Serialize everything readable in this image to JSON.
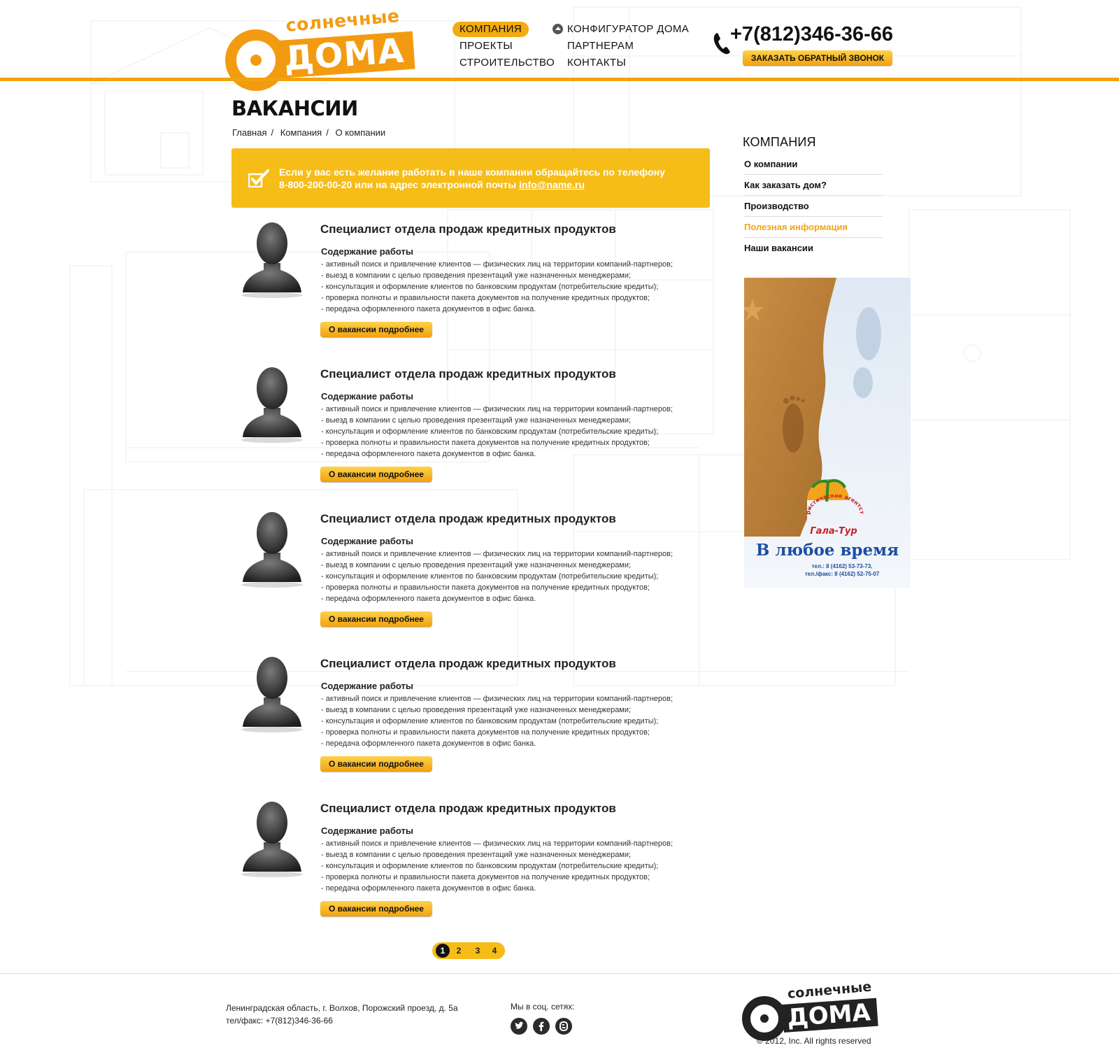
{
  "logo": {
    "top_text": "солнечные",
    "bottom_text": "ДОМА"
  },
  "nav": {
    "col1": [
      "КОМПАНИЯ",
      "ПРОЕКТЫ",
      "СТРОИТЕЛЬСТВО"
    ],
    "col2": [
      "КОНФИГУРАТОР ДОМА",
      "ПАРТНЕРАМ",
      "КОНТАКТЫ"
    ],
    "active": "КОМПАНИЯ"
  },
  "contact": {
    "phone": "+7(812)346-36-66",
    "callback_label": "ЗАКАЗАТЬ ОБРАТНЫЙ ЗВОНОК"
  },
  "page": {
    "title": "ВАКАНСИИ",
    "breadcrumb": [
      "Главная",
      "Компания",
      "О компании"
    ],
    "breadcrumb_sep": "/"
  },
  "notice": {
    "text_line1": "Если у вас есть желание работать в наше компании обращайтесь по телефону",
    "text_line2": "8-800-200-00-20 или на адрес электронной почты",
    "email": "info@name.ru"
  },
  "vacancies": [
    {
      "title": "Специалист отдела продаж кредитных продуктов",
      "subtitle": "Содержание работы",
      "duties": [
        "- активный поиск и привлечение клиентов — физических лиц на территории компаний-партнеров;",
        "- выезд в компании с целью проведения презентаций уже назначенных менеджерами;",
        "- консультация и оформление клиентов по банковским продуктам (потребительские кредиты);",
        "- проверка полноты и правильности пакета документов на получение кредитных продуктов;",
        "- передача оформленного пакета документов в офис банка."
      ],
      "button": "О вакансии подробнее"
    },
    {
      "title": "Специалист отдела продаж кредитных продуктов",
      "subtitle": "Содержание работы",
      "duties": [
        "- активный поиск и привлечение клиентов — физических лиц на территории компаний-партнеров;",
        "- выезд в компании с целью проведения презентаций уже назначенных менеджерами;",
        "- консультация и оформление клиентов по банковским продуктам (потребительские кредиты);",
        "- проверка полноты и правильности пакета документов на получение кредитных продуктов;",
        "- передача оформленного пакета документов в офис банка."
      ],
      "button": "О вакансии подробнее"
    },
    {
      "title": "Специалист отдела продаж кредитных продуктов",
      "subtitle": "Содержание работы",
      "duties": [
        "- активный поиск и привлечение клиентов — физических лиц на территории компаний-партнеров;",
        "- выезд в компании с целью проведения презентаций уже назначенных менеджерами;",
        "- консультация и оформление клиентов по банковским продуктам (потребительские кредиты);",
        "- проверка полноты и правильности пакета документов на получение кредитных продуктов;",
        "- передача оформленного пакета документов в офис банка."
      ],
      "button": "О вакансии подробнее"
    },
    {
      "title": "Специалист отдела продаж кредитных продуктов",
      "subtitle": "Содержание работы",
      "duties": [
        "- активный поиск и привлечение клиентов — физических лиц на территории компаний-партнеров;",
        "- выезд в компании с целью проведения презентаций уже назначенных менеджерами;",
        "- консультация и оформление клиентов по банковским продуктам (потребительские кредиты);",
        "- проверка полноты и правильности пакета документов на получение кредитных продуктов;",
        "- передача оформленного пакета документов в офис банка."
      ],
      "button": "О вакансии подробнее"
    },
    {
      "title": "Специалист отдела продаж кредитных продуктов",
      "subtitle": "Содержание работы",
      "duties": [
        "- активный поиск и привлечение клиентов — физических лиц на территории компаний-партнеров;",
        "- выезд в компании с целью проведения презентаций уже назначенных менеджерами;",
        "- консультация и оформление клиентов по банковским продуктам (потребительские кредиты);",
        "- проверка полноты и правильности пакета документов на получение кредитных продуктов;",
        "- передача оформленного пакета документов в офис банка."
      ],
      "button": "О вакансии подробнее"
    }
  ],
  "pagination": {
    "pages": [
      "1",
      "2",
      "3",
      "4"
    ],
    "current": "1"
  },
  "sidebar": {
    "title": "КОМПАНИЯ",
    "items": [
      "О компании",
      "Как заказать дом?",
      "Производство",
      "Полезная информация",
      "Наши вакансии"
    ],
    "accent_item": "Полезная информация"
  },
  "banner": {
    "agency": "туристическое агентство",
    "name": "Гала-Тур",
    "slogan": "В любое время",
    "phone1": "тел.: 8 (4162) 53-73-73,",
    "phone2": "тел./факс: 8 (4162) 52-75-07"
  },
  "footer": {
    "address": "Ленинградская область, г. Волхов, Порожский проезд, д. 5а",
    "phone": "тел/факс: +7(812)346-36-66",
    "social_label": "Мы в соц. сетях:",
    "social_icons": [
      "twitter-icon",
      "facebook-icon",
      "blogger-icon"
    ],
    "copyright": "© 2012, Inc. All rights reserved",
    "logo_top": "солнечные",
    "logo_bottom": "ДОМА"
  },
  "colors": {
    "accent": "#f2a40f",
    "notice_bg": "#f6bc18",
    "sidebar_accent": "#f2a512"
  }
}
